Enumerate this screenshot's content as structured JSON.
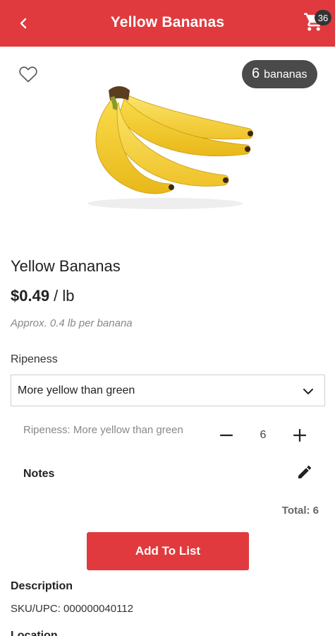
{
  "header": {
    "title": "Yellow Bananas",
    "back_icon": "chevron-left-icon",
    "cart_icon": "cart-icon",
    "cart_count": "36",
    "bar_color": "#e03a3e"
  },
  "product": {
    "favorite_icon": "heart-outline-icon",
    "count_pill": {
      "number": "6",
      "unit": "bananas"
    },
    "name": "Yellow Bananas",
    "price": {
      "amount": "$0.49",
      "unit": " / lb"
    },
    "approx": "Approx. 0.4 lb per banana"
  },
  "options": {
    "ripeness_label": "Ripeness",
    "ripeness_value": "More yellow than green",
    "chevron_icon": "chevron-down-icon"
  },
  "line_item": {
    "summary": "Ripeness: More yellow than green",
    "quantity": "6",
    "notes_label": "Notes",
    "edit_icon": "pencil-icon",
    "total": "Total: 6"
  },
  "actions": {
    "add_to_list": "Add To List"
  },
  "details": {
    "description_title": "Description",
    "sku": "SKU/UPC: 000000040112",
    "partial_heading": "Location"
  }
}
